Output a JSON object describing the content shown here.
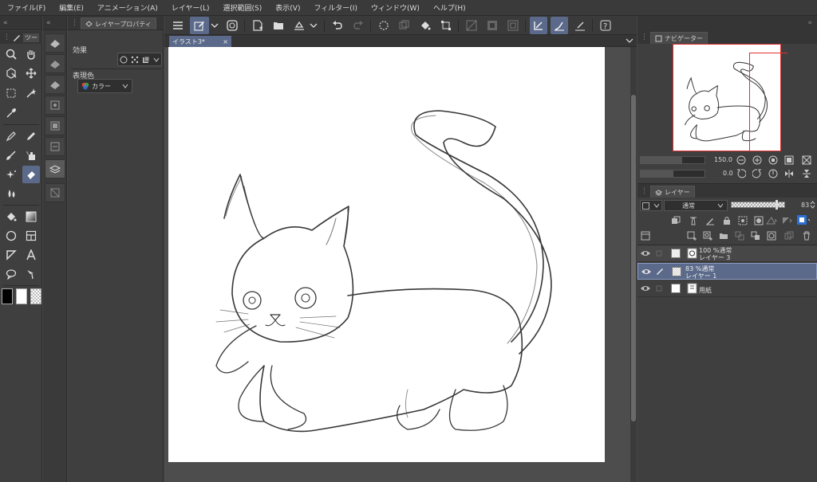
{
  "menu": [
    "ファイル(F)",
    "編集(E)",
    "アニメーション(A)",
    "レイヤー(L)",
    "選択範囲(S)",
    "表示(V)",
    "フィルター(I)",
    "ウィンドウ(W)",
    "ヘルプ(H)"
  ],
  "tool_panel": {
    "collapse": "«",
    "tab_label": "ツー"
  },
  "sub_panel": {
    "collapse": "«"
  },
  "layer_property": {
    "tab_label": "レイヤープロパティ",
    "effect_label": "効果",
    "expression_color_label": "表現色",
    "expression_color_value": "カラー"
  },
  "document": {
    "tab_label": "イラスト3*",
    "close": "×"
  },
  "navigator": {
    "tab_label": "ナビゲーター",
    "zoom": "150.0",
    "rotation": "0.0"
  },
  "layer_panel": {
    "tab_label": "レイヤー",
    "blend_mode": "通常",
    "opacity": "83",
    "layers": [
      {
        "line1": "100 %通常",
        "line2": "レイヤー 3",
        "selected": false
      },
      {
        "line1": "83 %通常",
        "line2": "レイヤー 1",
        "selected": true
      },
      {
        "line1": "",
        "line2": "用紙",
        "selected": false
      }
    ]
  },
  "colors": {
    "accent": "#5b6a8a",
    "background": "#3f3f3f",
    "paper": "#ffffff"
  }
}
